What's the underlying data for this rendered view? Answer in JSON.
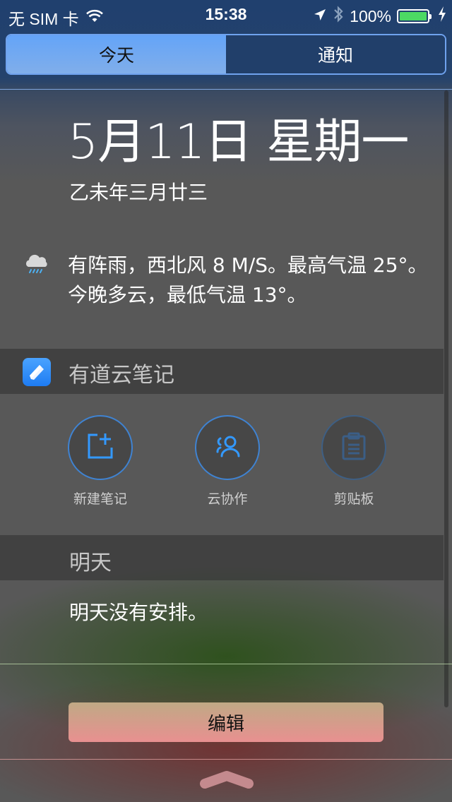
{
  "status_bar": {
    "carrier": "无 SIM 卡",
    "time": "15:38",
    "battery_percent_text": "100%",
    "battery_level": 1.0,
    "icons": [
      "wifi-icon",
      "location-arrow-icon",
      "bluetooth-icon",
      "battery-icon",
      "charging-bolt-icon"
    ]
  },
  "tabs": [
    {
      "label": "今天",
      "active": true
    },
    {
      "label": "通知",
      "active": false
    }
  ],
  "today": {
    "date": "5月11日 星期一",
    "lunar_date": "乙未年三月廿三",
    "weather": {
      "icon": "rain-cloud-icon",
      "summary": "有阵雨，西北风 8 M/S。最高气温 25°。今晚多云，最低气温 13°。"
    }
  },
  "widget": {
    "app_name": "有道云笔记",
    "app_icon": "pencil-app-icon",
    "actions": [
      {
        "label": "新建笔记",
        "icon": "new-note-icon"
      },
      {
        "label": "云协作",
        "icon": "collaboration-icon"
      },
      {
        "label": "剪贴板",
        "icon": "clipboard-icon"
      }
    ]
  },
  "tomorrow": {
    "title": "明天",
    "text": "明天没有安排。"
  },
  "footer": {
    "edit_label": "编辑",
    "grabber_icon": "chevron-up-icon"
  },
  "colors": {
    "accent_blue": "#3f83d2",
    "tab_active": "#64a4f8",
    "battery_green": "#4cd964",
    "edit_button_top": "#c0a985",
    "edit_button_bottom": "#e89090"
  }
}
